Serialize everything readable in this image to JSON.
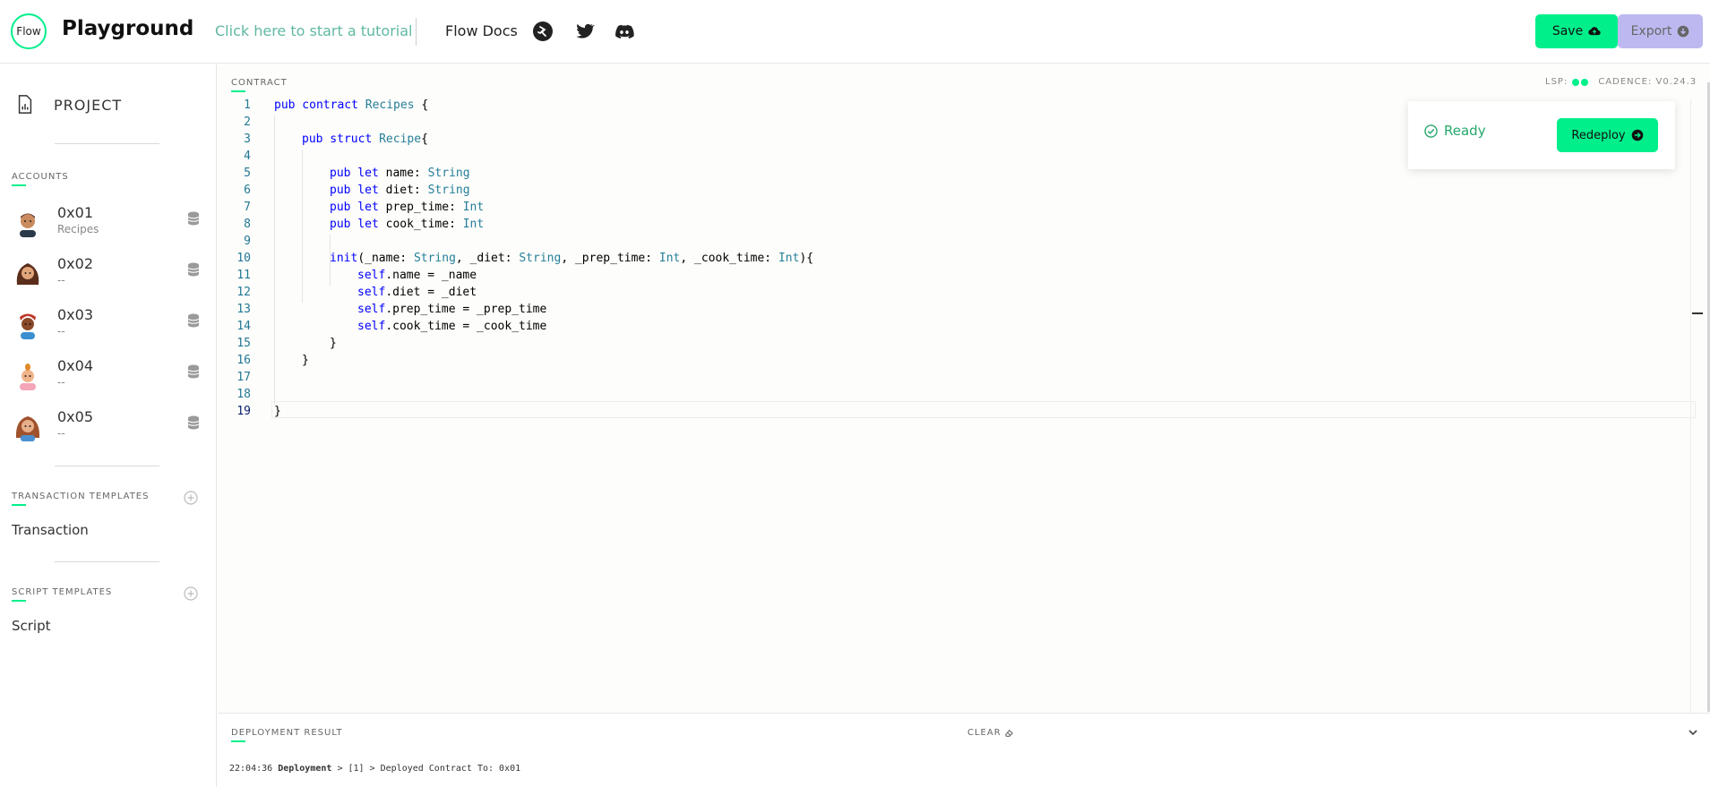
{
  "header": {
    "logo_text": "Flow",
    "title": "Playground",
    "tutorial_link": "Click here to start a tutorial",
    "docs_link": "Flow Docs",
    "save_label": "Save",
    "export_label": "Export",
    "icons": [
      "flow-runner-icon",
      "twitter-icon",
      "discord-icon",
      "cloud-upload-icon",
      "download-arrow-icon"
    ]
  },
  "sidebar": {
    "project_label": "PROJECT",
    "accounts_label": "ACCOUNTS",
    "accounts": [
      {
        "address": "0x01",
        "contract": "Recipes"
      },
      {
        "address": "0x02",
        "contract": "--"
      },
      {
        "address": "0x03",
        "contract": "--"
      },
      {
        "address": "0x04",
        "contract": "--"
      },
      {
        "address": "0x05",
        "contract": "--"
      }
    ],
    "transaction_templates_label": "TRANSACTION TEMPLATES",
    "transaction_item": "Transaction",
    "script_templates_label": "SCRIPT TEMPLATES",
    "script_item": "Script"
  },
  "editor": {
    "section_label": "CONTRACT",
    "lsp_label": "LSP:",
    "cadence_label": "CADENCE: V0.24.3",
    "line_numbers": [
      "1",
      "2",
      "3",
      "4",
      "5",
      "6",
      "7",
      "8",
      "9",
      "10",
      "11",
      "12",
      "13",
      "14",
      "15",
      "16",
      "17",
      "18",
      "19"
    ],
    "code": {
      "l1_kw": "pub contract",
      "l1_name": "Recipes",
      "l1_rest": " {",
      "l3_kw": "pub struct",
      "l3_name": "Recipe",
      "l3_rest": "{",
      "l5_kw": "pub let",
      "l5_id": " name: ",
      "l5_ty": "String",
      "l6_kw": "pub let",
      "l6_id": " diet: ",
      "l6_ty": "String",
      "l7_kw": "pub let",
      "l7_id": " prep_time: ",
      "l7_ty": "Int",
      "l8_kw": "pub let",
      "l8_id": " cook_time: ",
      "l8_ty": "Int",
      "l10_kw": "init",
      "l10_a": "(_name: ",
      "l10_t1": "String",
      "l10_b": ", _diet: ",
      "l10_t2": "String",
      "l10_c": ", _prep_time: ",
      "l10_t3": "Int",
      "l10_d": ", _cook_time: ",
      "l10_t4": "Int",
      "l10_e": "){",
      "l11_kw": "self",
      "l11_rest": ".name = _name",
      "l12_kw": "self",
      "l12_rest": ".diet = _diet",
      "l13_kw": "self",
      "l13_rest": ".prep_time = _prep_time",
      "l14_kw": "self",
      "l14_rest": ".cook_time = _cook_time",
      "l15": "}",
      "l16": "}",
      "l19": "}"
    }
  },
  "status_panel": {
    "status": "Ready",
    "redeploy_label": "Redeploy"
  },
  "deployment": {
    "section_label": "DEPLOYMENT RESULT",
    "clear_label": "CLEAR",
    "log_time": "22:04:36",
    "log_type": "Deployment",
    "log_message": " > [1] > Deployed Contract To: 0x01"
  },
  "colors": {
    "accent": "#00ef8b",
    "export_bg": "#bdb9f0",
    "keyword": "#0000ff",
    "type": "#267f99",
    "line_number": "#237893",
    "ready_text": "#25a86b"
  }
}
